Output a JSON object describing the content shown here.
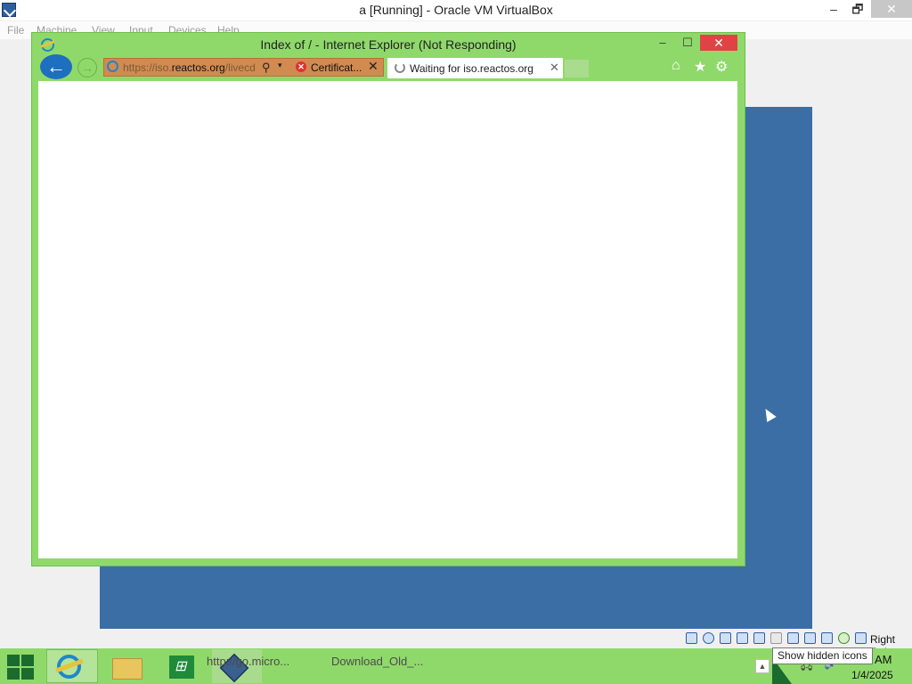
{
  "vbox": {
    "title": "a [Running] - Oracle VM VirtualBox",
    "controls": {
      "minimize": "–",
      "restore": "🗗",
      "close": "✕"
    },
    "menu": [
      "File",
      "Machine",
      "View",
      "Input",
      "Devices",
      "Help"
    ],
    "right_ctrl": "Right Ctrl",
    "status_icons": [
      "hard-disk-icon",
      "optical-disk-icon",
      "audio-icon",
      "network-icon",
      "usb-icon",
      "shared-folders-icon",
      "display-icon",
      "video-capture-icon",
      "recording-icon",
      "cpu-icon",
      "mouse-integration-icon",
      "keyboard-icon"
    ]
  },
  "ie": {
    "title": "Index of / - Internet Explorer (Not Responding)",
    "controls": {
      "minimize": "–",
      "maximize": "☐",
      "close": "✕"
    },
    "back_glyph": "←",
    "forward_glyph": "→",
    "address": {
      "url_prefix": "https://iso.",
      "url_domain": "reactos.org",
      "url_suffix": "/livecd",
      "search_glyph": "⚲",
      "dropdown_glyph": "▾",
      "cert_label": "Certificat...",
      "cert_glyph": "✕",
      "close_glyph": "✕"
    },
    "tab": {
      "label": "Waiting for iso.reactos.org",
      "close_glyph": "✕"
    },
    "tools": {
      "home": "⌂",
      "favorites": "★",
      "settings": "⚙"
    }
  },
  "taskbar": {
    "item_texts": [
      "http://go.micro...",
      "Download_Old_..."
    ],
    "tray_up": "▲",
    "tray_icons": [
      "🖧",
      "🔊"
    ],
    "clock": {
      "time": "AM",
      "date": "1/4/2025"
    }
  },
  "tooltip": "Show hidden icons",
  "colors": {
    "ie_frame": "#8fd96b",
    "taskbar": "#8fd96b",
    "desktop": "#3a6ea5",
    "ie_close": "#e04343",
    "address_bar": "#d18a50"
  }
}
